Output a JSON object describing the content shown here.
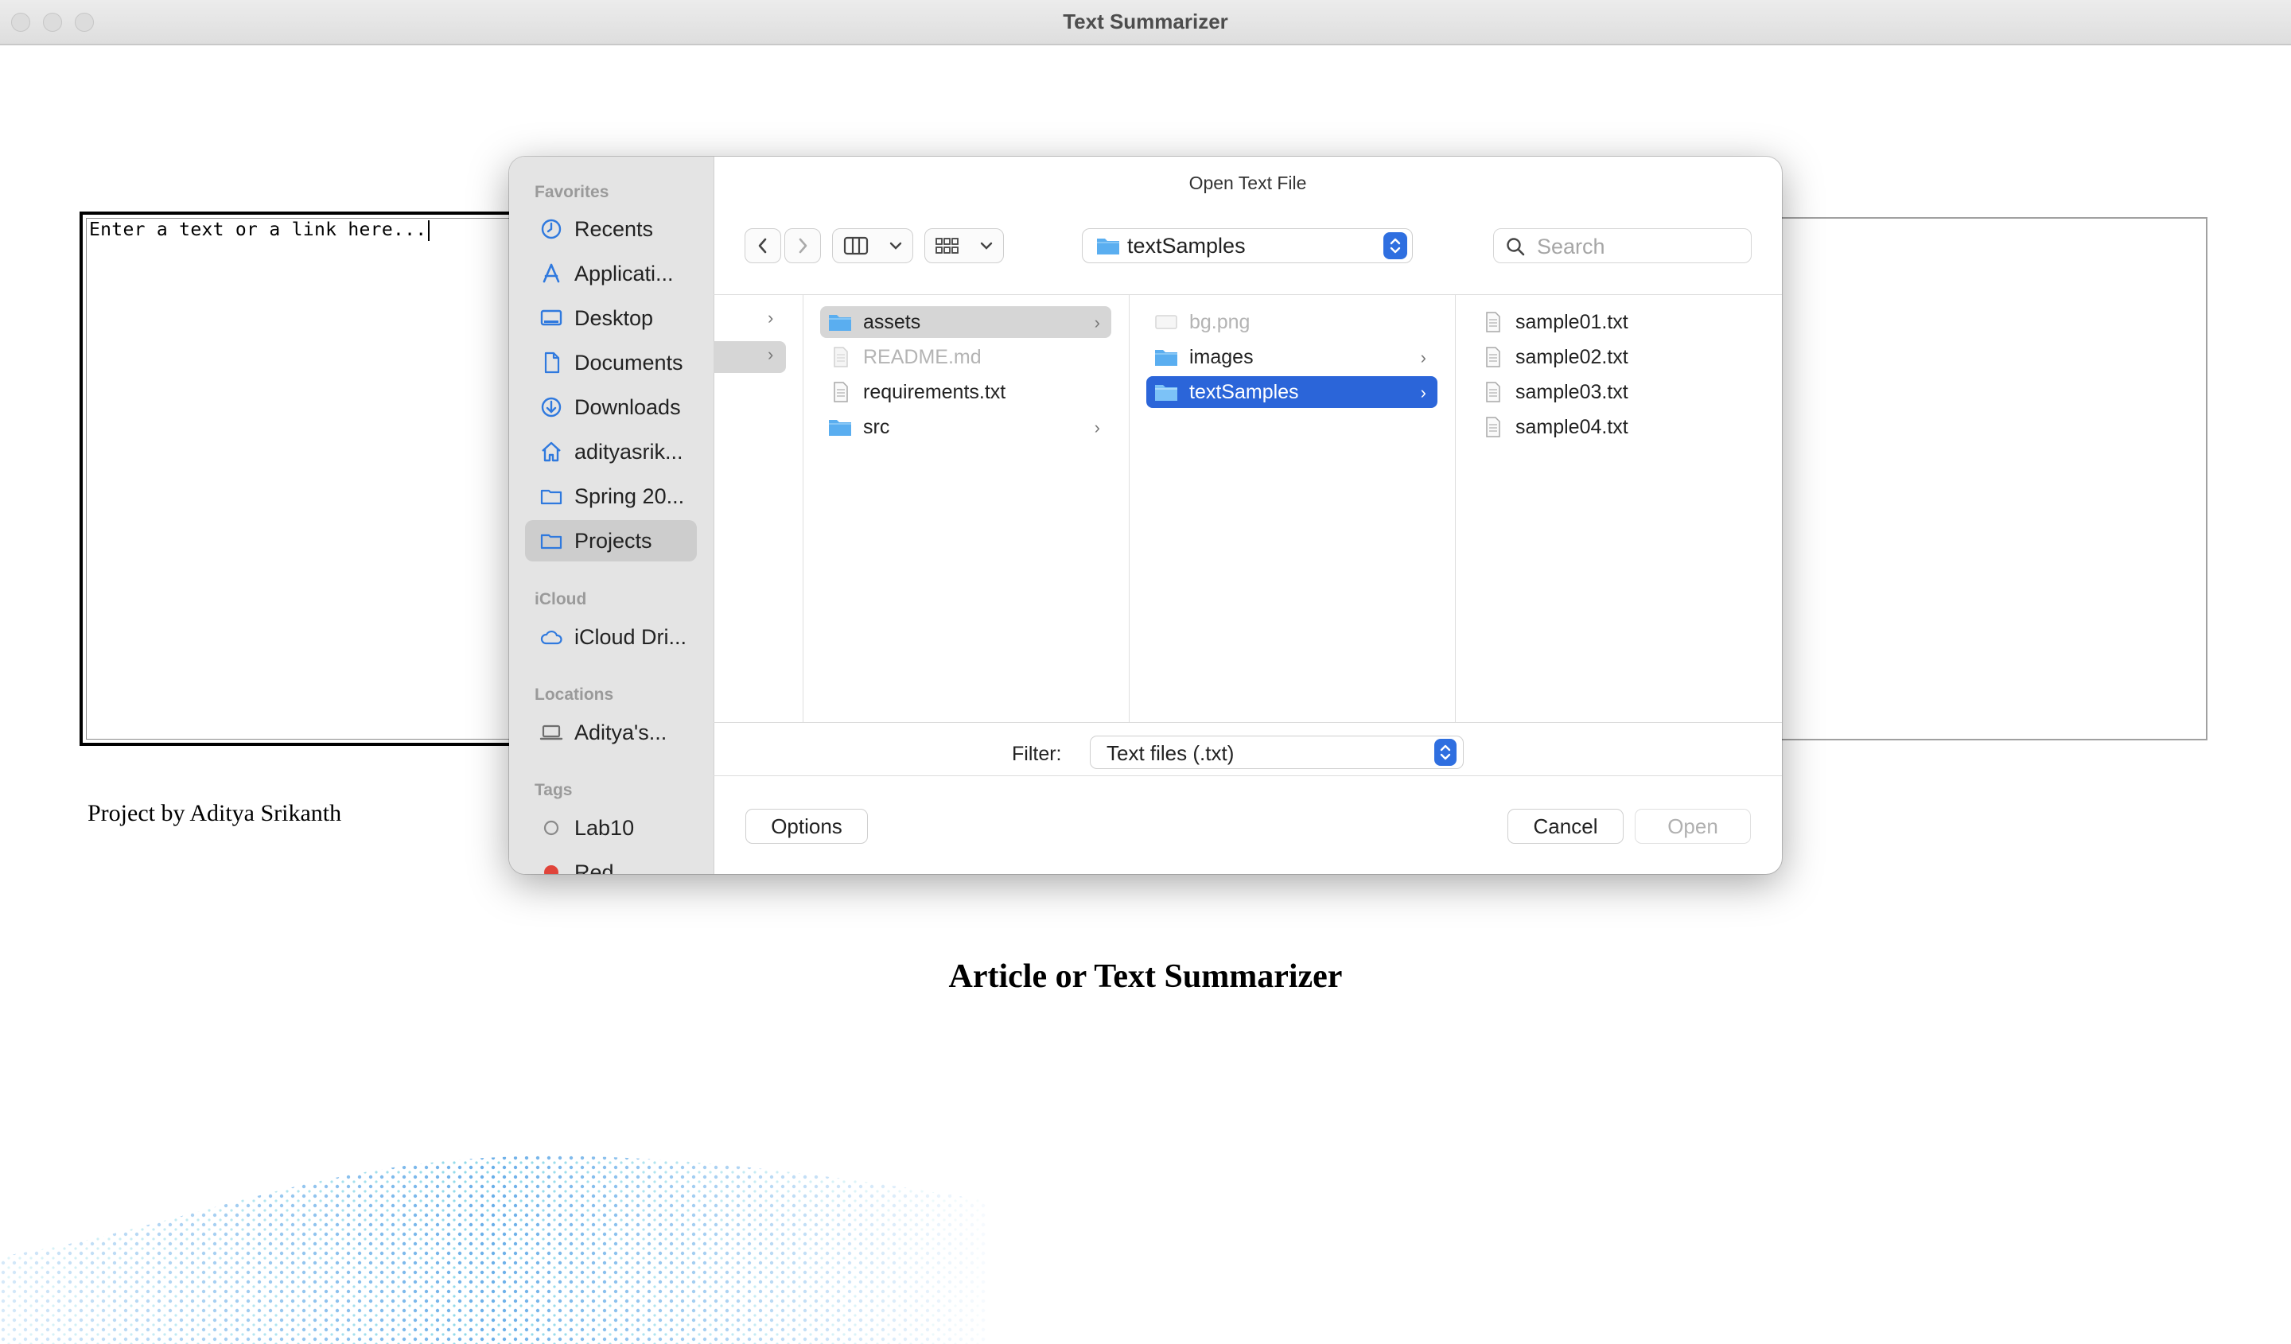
{
  "window": {
    "title": "Text Summarizer"
  },
  "app": {
    "input_placeholder": "Enter a text or a link here...",
    "credit": "Project by Aditya Srikanth",
    "heading": "Article or Text Summarizer"
  },
  "dialog": {
    "title": "Open Text File",
    "location": "textSamples",
    "search_placeholder": "Search",
    "sidebar": {
      "favorites_header": "Favorites",
      "favorites": [
        {
          "label": "Recents",
          "icon": "clock-icon"
        },
        {
          "label": "Applicati...",
          "icon": "applications-icon"
        },
        {
          "label": "Desktop",
          "icon": "desktop-icon"
        },
        {
          "label": "Documents",
          "icon": "document-icon"
        },
        {
          "label": "Downloads",
          "icon": "download-icon"
        },
        {
          "label": "adityasrik...",
          "icon": "home-icon"
        },
        {
          "label": "Spring 20...",
          "icon": "folder-icon"
        },
        {
          "label": "Projects",
          "icon": "folder-icon"
        }
      ],
      "icloud_header": "iCloud",
      "icloud": [
        {
          "label": "iCloud Dri...",
          "icon": "cloud-icon"
        }
      ],
      "locations_header": "Locations",
      "locations": [
        {
          "label": "Aditya's...",
          "icon": "laptop-icon"
        }
      ],
      "tags_header": "Tags",
      "tags": [
        {
          "label": "Lab10",
          "color": "#8a8a8a"
        },
        {
          "label": "Red",
          "color": "#e0443a"
        }
      ]
    },
    "columns": {
      "col2": [
        {
          "name": "assets",
          "kind": "folder",
          "chevron": true
        },
        {
          "name": "README.md",
          "kind": "file",
          "disabled": true
        },
        {
          "name": "requirements.txt",
          "kind": "file"
        },
        {
          "name": "src",
          "kind": "folder",
          "chevron": true
        }
      ],
      "col3": [
        {
          "name": "bg.png",
          "kind": "image",
          "disabled": true
        },
        {
          "name": "images",
          "kind": "folder",
          "chevron": true
        },
        {
          "name": "textSamples",
          "kind": "folder",
          "chevron": true,
          "selected": true
        }
      ],
      "col4": [
        {
          "name": "sample01.txt",
          "kind": "file"
        },
        {
          "name": "sample02.txt",
          "kind": "file"
        },
        {
          "name": "sample03.txt",
          "kind": "file"
        },
        {
          "name": "sample04.txt",
          "kind": "file"
        }
      ]
    },
    "filter_label": "Filter:",
    "filter_value": "Text files (.txt)",
    "buttons": {
      "options": "Options",
      "cancel": "Cancel",
      "open": "Open"
    }
  },
  "colors": {
    "accent": "#2b65d9",
    "folder": "#5aaef0",
    "sidebar_icon": "#2f79de"
  }
}
